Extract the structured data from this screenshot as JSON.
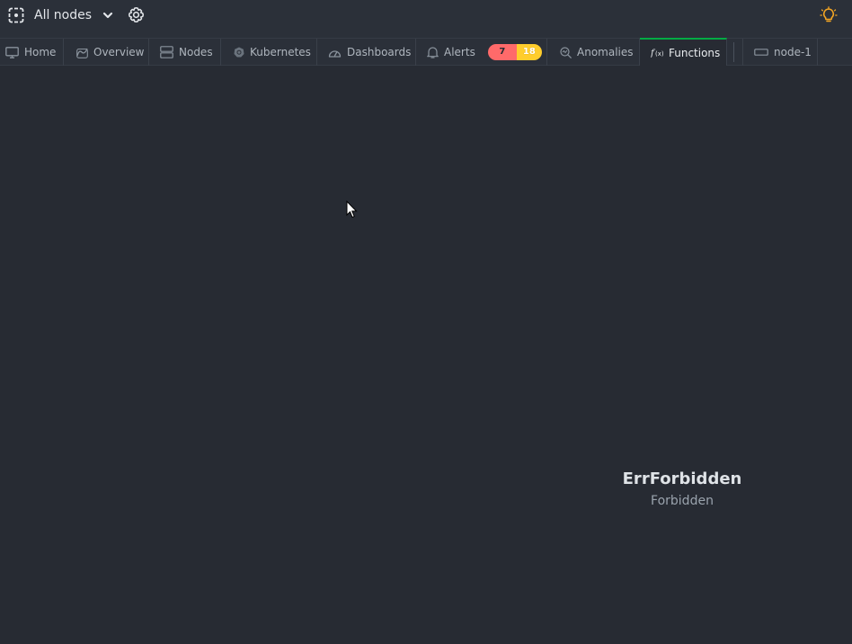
{
  "header": {
    "space_name": "All nodes"
  },
  "tabs": [
    {
      "label": "Home",
      "icon": "monitor-icon"
    },
    {
      "label": "Overview",
      "icon": "overview-icon"
    },
    {
      "label": "Nodes",
      "icon": "nodes-icon"
    },
    {
      "label": "Kubernetes",
      "icon": "kubernetes-icon"
    },
    {
      "label": "Dashboards",
      "icon": "dashboard-icon"
    },
    {
      "label": "Alerts",
      "icon": "bell-icon"
    },
    {
      "label": "Anomalies",
      "icon": "anomalies-icon"
    },
    {
      "label": "Functions",
      "icon": "functions-icon",
      "active": true
    },
    {
      "label": "node-1",
      "icon": "node-icon"
    }
  ],
  "alerts": {
    "critical_count": "7",
    "warning_count": "18",
    "critical_color": "#ff6a6a",
    "warning_color": "#ffcd2c"
  },
  "accent_color": "#00ab44",
  "error": {
    "title": "ErrForbidden",
    "message": "Forbidden"
  }
}
